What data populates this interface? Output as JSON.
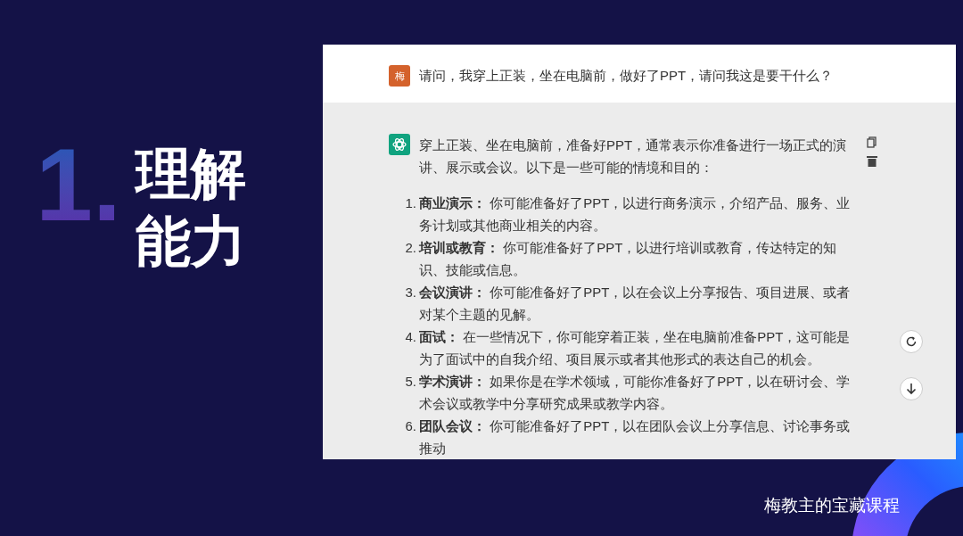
{
  "slide": {
    "number": "1.",
    "title_lines": [
      "理解",
      "能力"
    ],
    "footer": "梅教主的宝藏课程"
  },
  "chat": {
    "user": {
      "avatar": "梅",
      "message": "请问，我穿上正装，坐在电脑前，做好了PPT，请问我这是要干什么？"
    },
    "assistant": {
      "intro": "穿上正装、坐在电脑前，准备好PPT，通常表示你准备进行一场正式的演讲、展示或会议。以下是一些可能的情境和目的：",
      "items": [
        {
          "number": "1.",
          "text": "**商业演示：** 你可能准备好了PPT，以进行商务演示，介绍产品、服务、业务计划或其他商业相关的内容。"
        },
        {
          "number": "2.",
          "text": "**培训或教育：** 你可能准备好了PPT，以进行培训或教育，传达特定的知识、技能或信息。"
        },
        {
          "number": "3.",
          "text": "**会议演讲：** 你可能准备好了PPT，以在会议上分享报告、项目进展、或者对某个主题的见解。"
        },
        {
          "number": "4.",
          "text": "**面试：** 在一些情况下，你可能穿着正装，坐在电脑前准备PPT，这可能是为了面试中的自我介绍、项目展示或者其他形式的表达自己的机会。"
        },
        {
          "number": "5.",
          "text": "**学术演讲：** 如果你是在学术领域，可能你准备好了PPT，以在研讨会、学术会议或教学中分享研究成果或教学内容。"
        },
        {
          "number": "6.",
          "text": "**团队会议：** 你可能准备好了PPT，以在团队会议上分享信息、讨论事务或推动"
        }
      ]
    }
  }
}
